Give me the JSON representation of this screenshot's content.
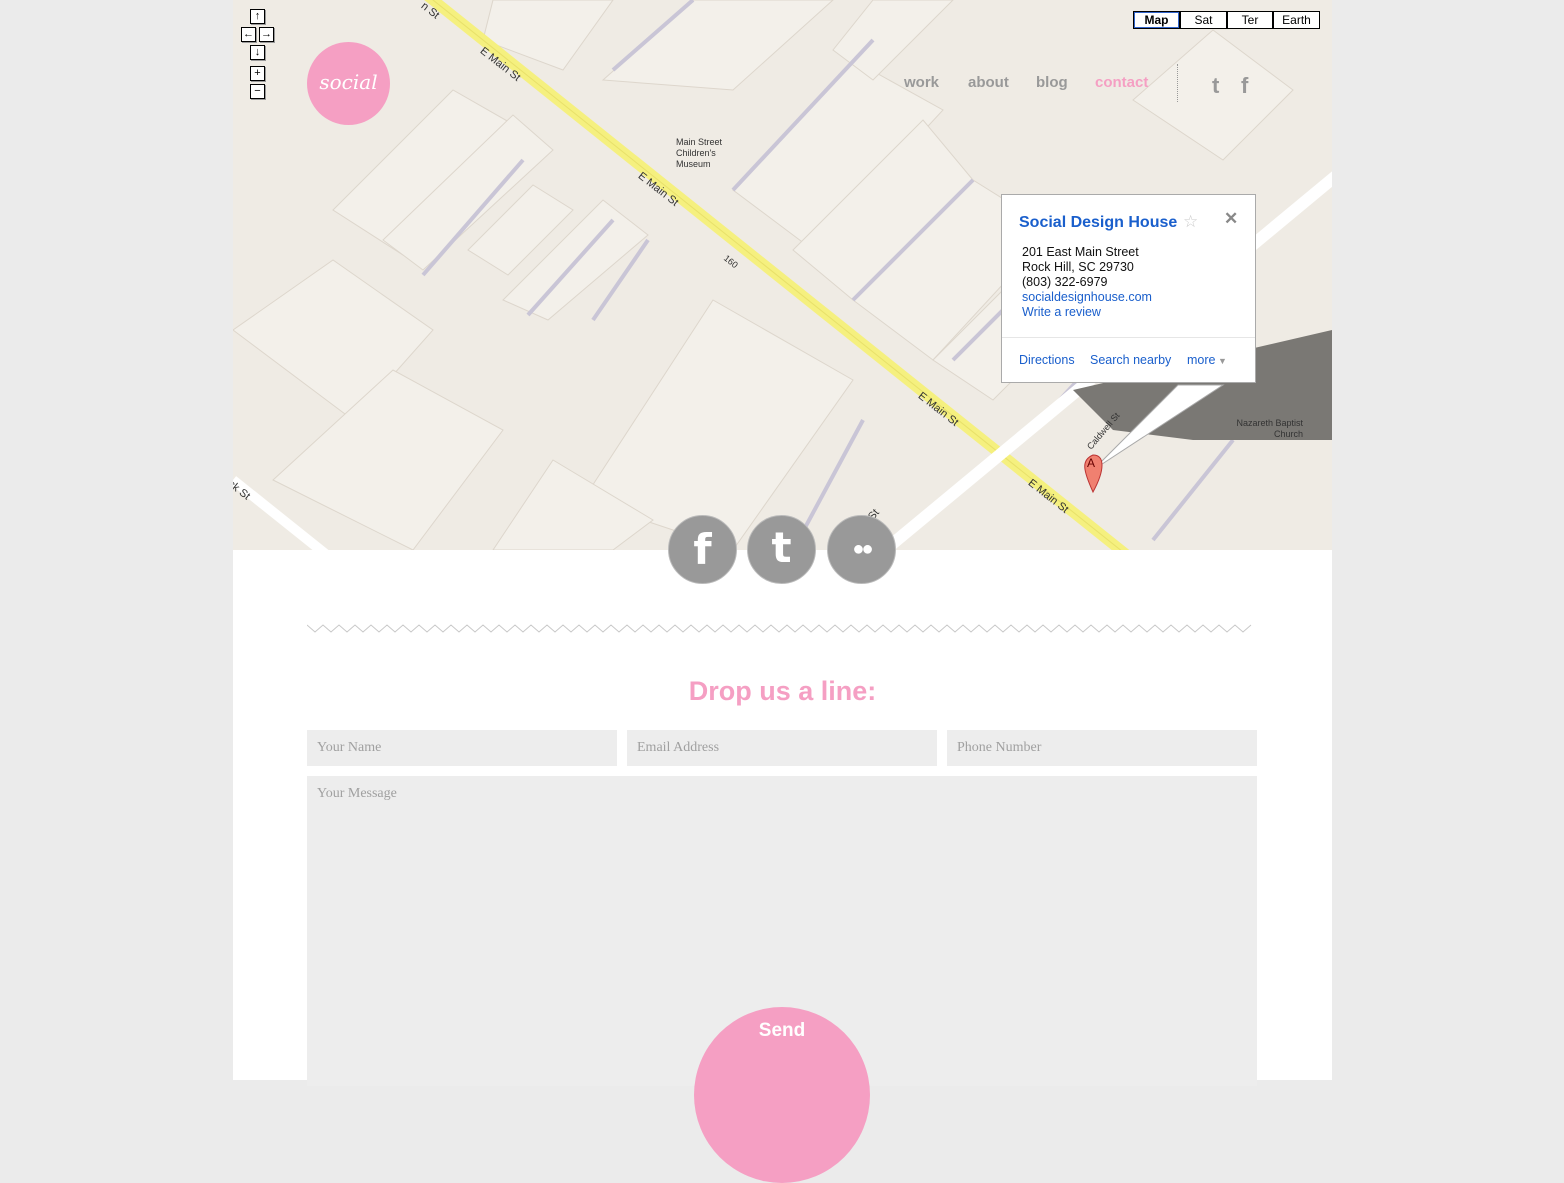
{
  "map": {
    "controls": {
      "up": "↑",
      "left": "←",
      "right": "→",
      "down": "↓",
      "zoom_in": "+",
      "zoom_out": "−"
    },
    "types": [
      "Map",
      "Sat",
      "Ter",
      "Earth"
    ],
    "selected_type": "Map",
    "labels": {
      "street1": "E Main St",
      "street2": "E Main St",
      "street3": "E Main St",
      "street4": "E Main St",
      "street_top": "n St",
      "street_left": "ck St",
      "street_bottom": "St",
      "route": "160",
      "caldwell": "Caldwell St",
      "museum": "Main Street Children's Museum",
      "church": "Nazareth Baptist Church"
    },
    "marker": "A",
    "info": {
      "title": "Social Design House",
      "address1": "201 East Main Street",
      "address2": "Rock Hill, SC 29730",
      "phone": "(803) 322-6979",
      "website": "socialdesignhouse.com",
      "review": "Write a review",
      "actions": [
        "Directions",
        "Search nearby",
        "more"
      ]
    }
  },
  "header": {
    "logo": "social",
    "nav": [
      "work",
      "about",
      "blog",
      "contact"
    ],
    "active": "contact",
    "social": {
      "twitter": "t",
      "facebook": "f"
    }
  },
  "social_circles": {
    "facebook": "f",
    "twitter": "t",
    "flickr": "●●"
  },
  "form": {
    "heading": "Drop us a line:",
    "name_placeholder": "Your Name",
    "email_placeholder": "Email Address",
    "phone_placeholder": "Phone Number",
    "message_placeholder": "Your Message",
    "send": "Send"
  },
  "colors": {
    "accent": "#f59fc3",
    "gray": "#999999",
    "link": "#1a5fcc"
  }
}
